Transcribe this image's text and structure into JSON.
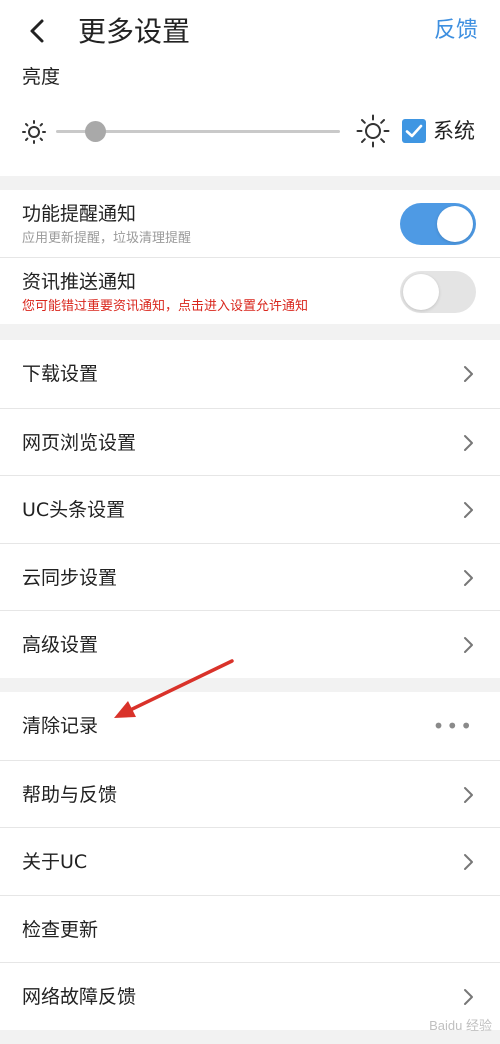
{
  "header": {
    "title": "更多设置",
    "feedback_label": "反馈"
  },
  "brightness": {
    "label": "亮度",
    "level_fraction": 0.14,
    "system_label": "系统",
    "system_checked": true
  },
  "notifications": [
    {
      "title": "功能提醒通知",
      "subtitle": "应用更新提醒，垃圾清理提醒",
      "enabled": true
    },
    {
      "title": "资讯推送通知",
      "subtitle": "您可能错过重要资讯通知，点击进入设置允许通知",
      "enabled": false
    }
  ],
  "settings_group": [
    {
      "label": "下载设置"
    },
    {
      "label": "网页浏览设置"
    },
    {
      "label": "UC头条设置"
    },
    {
      "label": "云同步设置"
    },
    {
      "label": "高级设置"
    }
  ],
  "misc_group": [
    {
      "label": "清除记录",
      "trailing": "more"
    },
    {
      "label": "帮助与反馈",
      "trailing": "chevron"
    },
    {
      "label": "关于UC",
      "trailing": "chevron"
    },
    {
      "label": "检查更新",
      "trailing": "none"
    },
    {
      "label": "网络故障反馈",
      "trailing": "chevron"
    }
  ],
  "more_glyph": "•••",
  "watermark_text": "Baidu 经验",
  "colors": {
    "accent": "#3d8fe0",
    "toggle_on": "#4e9ae4",
    "warning": "#d9261c",
    "annotation_arrow": "#d9322a"
  }
}
